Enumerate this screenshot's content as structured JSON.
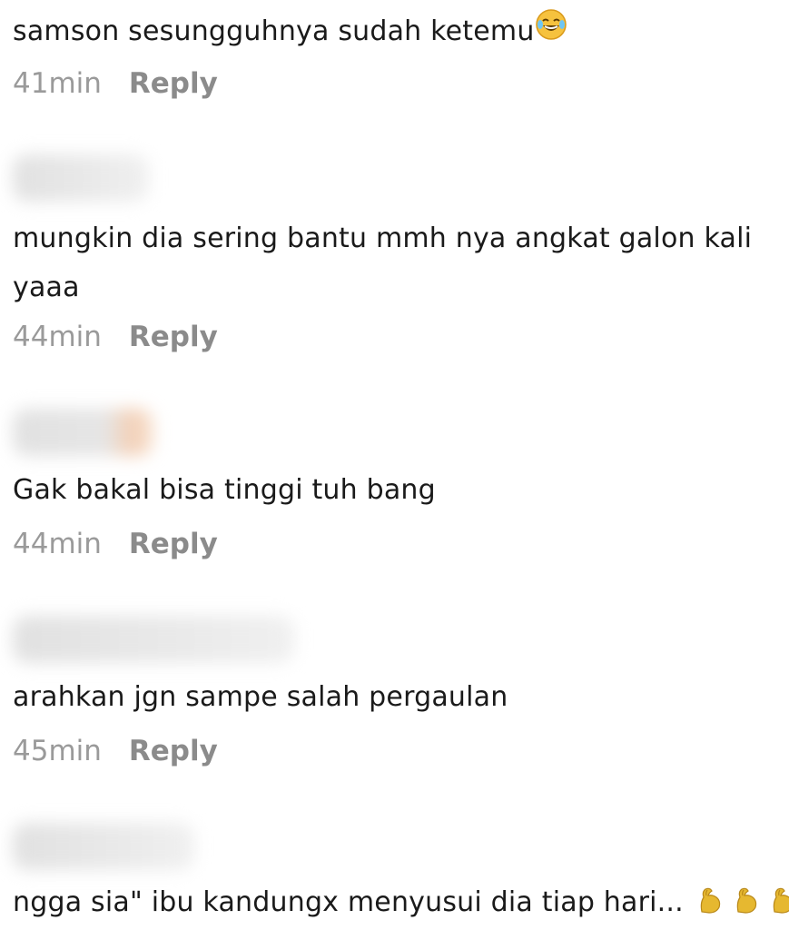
{
  "comments": [
    {
      "text": "samson sesungguhnya sudah ketemu",
      "emoji": "laughing-tears-emoji",
      "time": "41min",
      "reply": "Reply"
    },
    {
      "text": "mungkin dia sering bantu mmh nya angkat galon kali yaaa",
      "time": "44min",
      "reply": "Reply"
    },
    {
      "text": "Gak bakal bisa tinggi tuh bang",
      "time": "44min",
      "reply": "Reply"
    },
    {
      "text": "arahkan jgn sampe salah pergaulan",
      "time": "45min",
      "reply": "Reply"
    },
    {
      "text": "ngga sia\" ibu kandungx menyusui dia tiap hari...",
      "emoji": "flexed-biceps-emoji"
    }
  ],
  "colors": {
    "text": "#1a1a1a",
    "time": "#9a9a9a",
    "reply": "#8b8b8b",
    "emoji_face": "#f6c23e",
    "emoji_arm": "#e6b830"
  }
}
